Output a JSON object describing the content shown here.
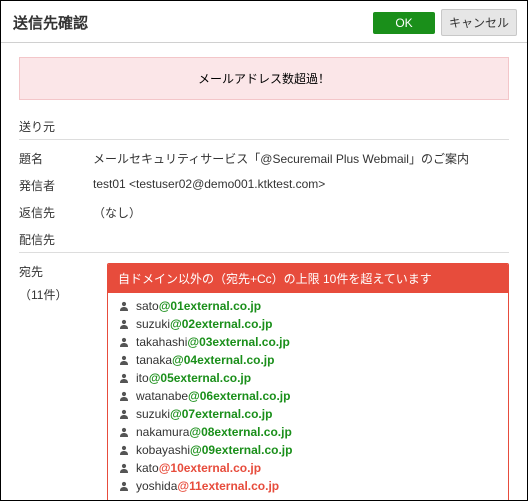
{
  "title": "送信先確認",
  "buttons": {
    "ok": "OK",
    "cancel": "キャンセル"
  },
  "alert": "メールアドレス数超過！",
  "sections": {
    "sender": "送り元",
    "distribution": "配信先"
  },
  "fields": {
    "subject_label": "題名",
    "subject_value": "メールセキュリティサービス「@Securemail Plus Webmail」のご案内",
    "from_label": "発信者",
    "from_value": "test01 <testuser02@demo001.ktktest.com>",
    "replyto_label": "返信先",
    "replyto_value": "（なし）"
  },
  "distribution": {
    "to_label": "宛先",
    "count_text": "（11件）",
    "warning": "自ドメイン以外の（宛先+Cc）の上限 10件を超えています",
    "recipients": [
      {
        "local": "sato",
        "domain": "01external.co.jp",
        "over": false
      },
      {
        "local": "suzuki",
        "domain": "02external.co.jp",
        "over": false
      },
      {
        "local": "takahashi",
        "domain": "03external.co.jp",
        "over": false
      },
      {
        "local": "tanaka",
        "domain": "04external.co.jp",
        "over": false
      },
      {
        "local": "ito",
        "domain": "05external.co.jp",
        "over": false
      },
      {
        "local": "watanabe",
        "domain": "06external.co.jp",
        "over": false
      },
      {
        "local": "suzuki",
        "domain": "07external.co.jp",
        "over": false
      },
      {
        "local": "nakamura",
        "domain": "08external.co.jp",
        "over": false
      },
      {
        "local": "kobayashi",
        "domain": "09external.co.jp",
        "over": false
      },
      {
        "local": "kato",
        "domain": "10external.co.jp",
        "over": true
      },
      {
        "local": "yoshida",
        "domain": "11external.co.jp",
        "over": true
      }
    ]
  }
}
